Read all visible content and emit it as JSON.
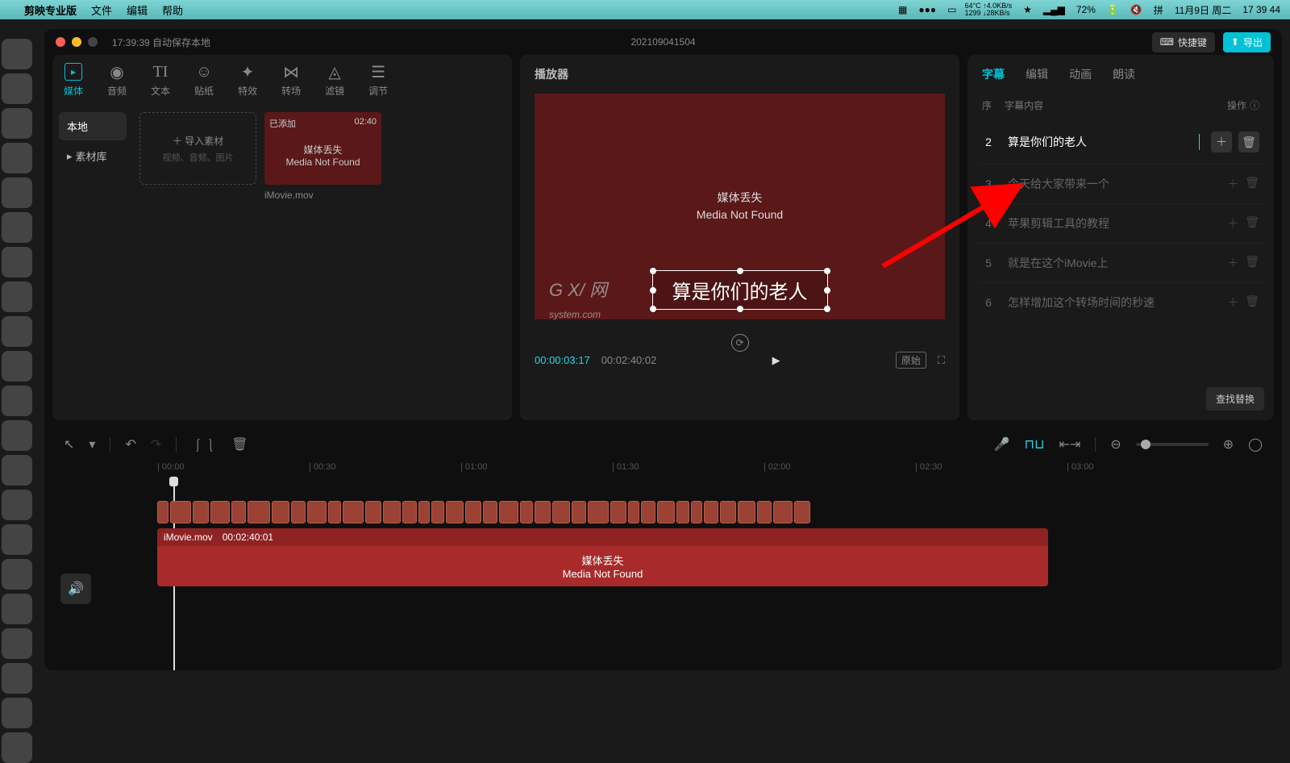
{
  "menubar": {
    "app_name": "剪映专业版",
    "items": [
      "文件",
      "编辑",
      "帮助"
    ],
    "cpu_temp": "64°C",
    "net_up": "↑4.0KB/s",
    "net_cpu": "1299",
    "net_down": "↓28KB/s",
    "battery": "72%",
    "date": "11月9日 周二",
    "time": "17 39 44"
  },
  "titlebar": {
    "autosave": "17:39:39 自动保存本地",
    "project": "202109041504",
    "shortcut_btn": "快捷键",
    "export_btn": "导出"
  },
  "tool_tabs": [
    {
      "label": "媒体",
      "active": true
    },
    {
      "label": "音频"
    },
    {
      "label": "文本"
    },
    {
      "label": "贴纸"
    },
    {
      "label": "特效"
    },
    {
      "label": "转场"
    },
    {
      "label": "滤镜"
    },
    {
      "label": "调节"
    }
  ],
  "left_sidebar": {
    "items": [
      "本地",
      "素材库"
    ],
    "active": 0
  },
  "import_box": {
    "title": "导入素材",
    "sub": "视频、音频、图片"
  },
  "media_item": {
    "badge": "已添加",
    "duration": "02:40",
    "line1": "媒体丢失",
    "line2": "Media Not Found",
    "filename": "iMovie.mov"
  },
  "preview": {
    "title": "播放器",
    "mnf1": "媒体丢失",
    "mnf2": "Media Not Found",
    "caption": "算是你们的老人",
    "cur_time": "00:00:03:17",
    "total_time": "00:02:40:02",
    "aspect": "原始",
    "watermark_main": "G X/ 网",
    "watermark_sub": "system.com"
  },
  "right_tabs": [
    "字幕",
    "编辑",
    "动画",
    "朗读"
  ],
  "right_head": {
    "seq": "序",
    "content": "字幕内容",
    "ops": "操作"
  },
  "subtitles": [
    {
      "n": "2",
      "text": "算是你们的老人",
      "active": true
    },
    {
      "n": "3",
      "text": "今天给大家带来一个"
    },
    {
      "n": "4",
      "text": "苹果剪辑工具的教程"
    },
    {
      "n": "5",
      "text": "就是在这个iMovie上"
    },
    {
      "n": "6",
      "text": "怎样增加这个转场时间的秒速"
    }
  ],
  "find_replace": "查找替换",
  "ruler_ticks": [
    "00:00",
    "00:30",
    "01:00",
    "01:30",
    "02:00",
    "02:30",
    "03:00"
  ],
  "video_track": {
    "name": "iMovie.mov",
    "dur": "00:02:40:01",
    "l1": "媒体丢失",
    "l2": "Media Not Found"
  }
}
